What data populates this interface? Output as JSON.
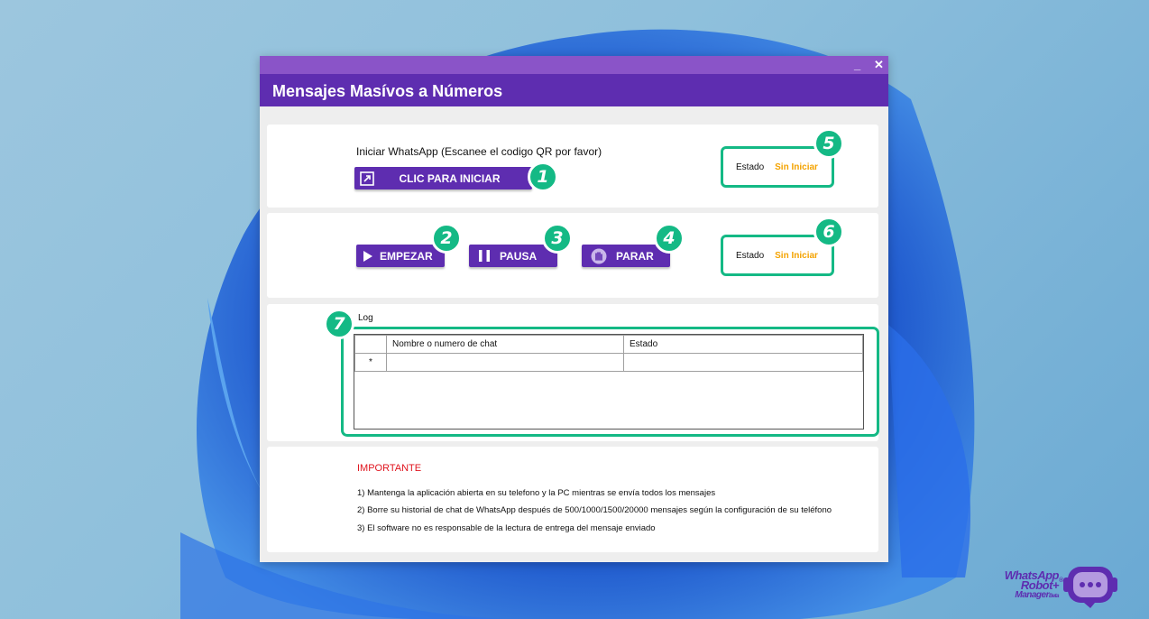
{
  "window": {
    "title": "Mensajes Masívos a Números",
    "minimize": "_",
    "close": "✕"
  },
  "start_section": {
    "instruction": "Iniciar WhatsApp (Escanee el codigo QR por favor)",
    "button_label": "CLIC PARA INICIAR",
    "status_label": "Estado",
    "status_value": "Sin Iniciar"
  },
  "control_section": {
    "start_label": "EMPEZAR",
    "pause_label": "PAUSA",
    "stop_label": "PARAR",
    "status_label": "Estado",
    "status_value": "Sin Iniciar"
  },
  "log_section": {
    "label": "Log",
    "columns": [
      "Nombre o numero de chat",
      "Estado"
    ],
    "new_row_marker": "*"
  },
  "important": {
    "title": "IMPORTANTE",
    "notes": [
      "1) Mantenga la aplicación abierta en su telefono y la PC mientras se envía todos los mensajes",
      "2) Borre su historial de chat de WhatsApp después de 500/1000/1500/20000 mensajes según la configuración de su teléfono",
      "3) El software no es responsable de la lectura de entrega del mensaje enviado"
    ]
  },
  "badges": [
    "1",
    "2",
    "3",
    "4",
    "5",
    "6",
    "7"
  ],
  "logo": {
    "line1": "WhatsApp",
    "line2": "Robot+",
    "line3": "Manager",
    "tag": "Beta",
    "reg": "®"
  },
  "colors": {
    "accent": "#5e2db0",
    "titlebar": "#8a54c8",
    "highlight": "#14b985",
    "status": "#f4a300",
    "important": "#e0141e"
  }
}
